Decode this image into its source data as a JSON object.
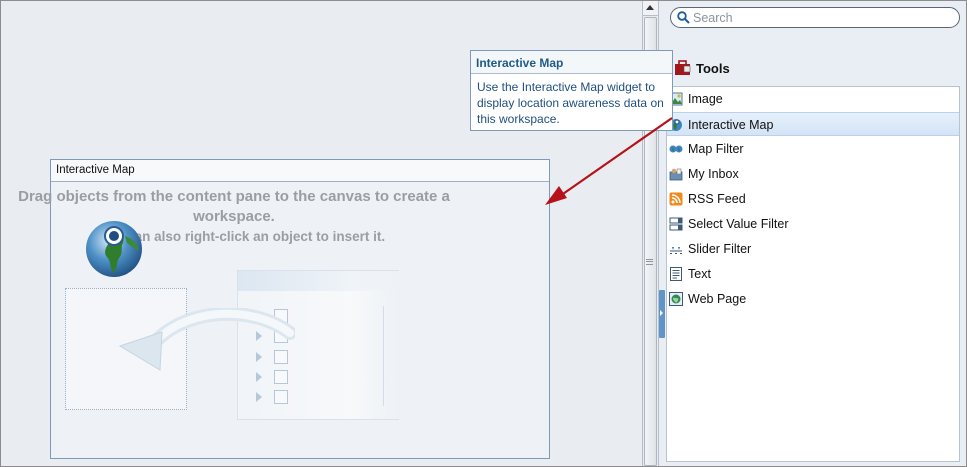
{
  "search": {
    "placeholder": "Search"
  },
  "tools": {
    "heading": "Tools",
    "items": [
      {
        "label": "Image",
        "icon": "image-icon"
      },
      {
        "label": "Interactive Map",
        "icon": "globe-icon",
        "selected": true
      },
      {
        "label": "Map Filter",
        "icon": "map-filter-icon"
      },
      {
        "label": "My Inbox",
        "icon": "inbox-icon"
      },
      {
        "label": "RSS Feed",
        "icon": "rss-icon"
      },
      {
        "label": "Select Value Filter",
        "icon": "select-value-filter-icon"
      },
      {
        "label": "Slider Filter",
        "icon": "slider-filter-icon"
      },
      {
        "label": "Text",
        "icon": "text-icon"
      },
      {
        "label": "Web Page",
        "icon": "web-page-icon"
      }
    ]
  },
  "tooltip": {
    "title": "Interactive Map",
    "body": "Use the Interactive Map widget to display location awareness data on this workspace."
  },
  "widget": {
    "title": "Interactive Map",
    "hint_line1": "Drag objects from the content pane to the canvas to create a workspace.",
    "hint_line2": "You can also right-click an object to insert it."
  },
  "colors": {
    "selection": "#d4e4f6",
    "callout_arrow": "#b5121b",
    "tooltip_title": "#1f5a8a"
  }
}
